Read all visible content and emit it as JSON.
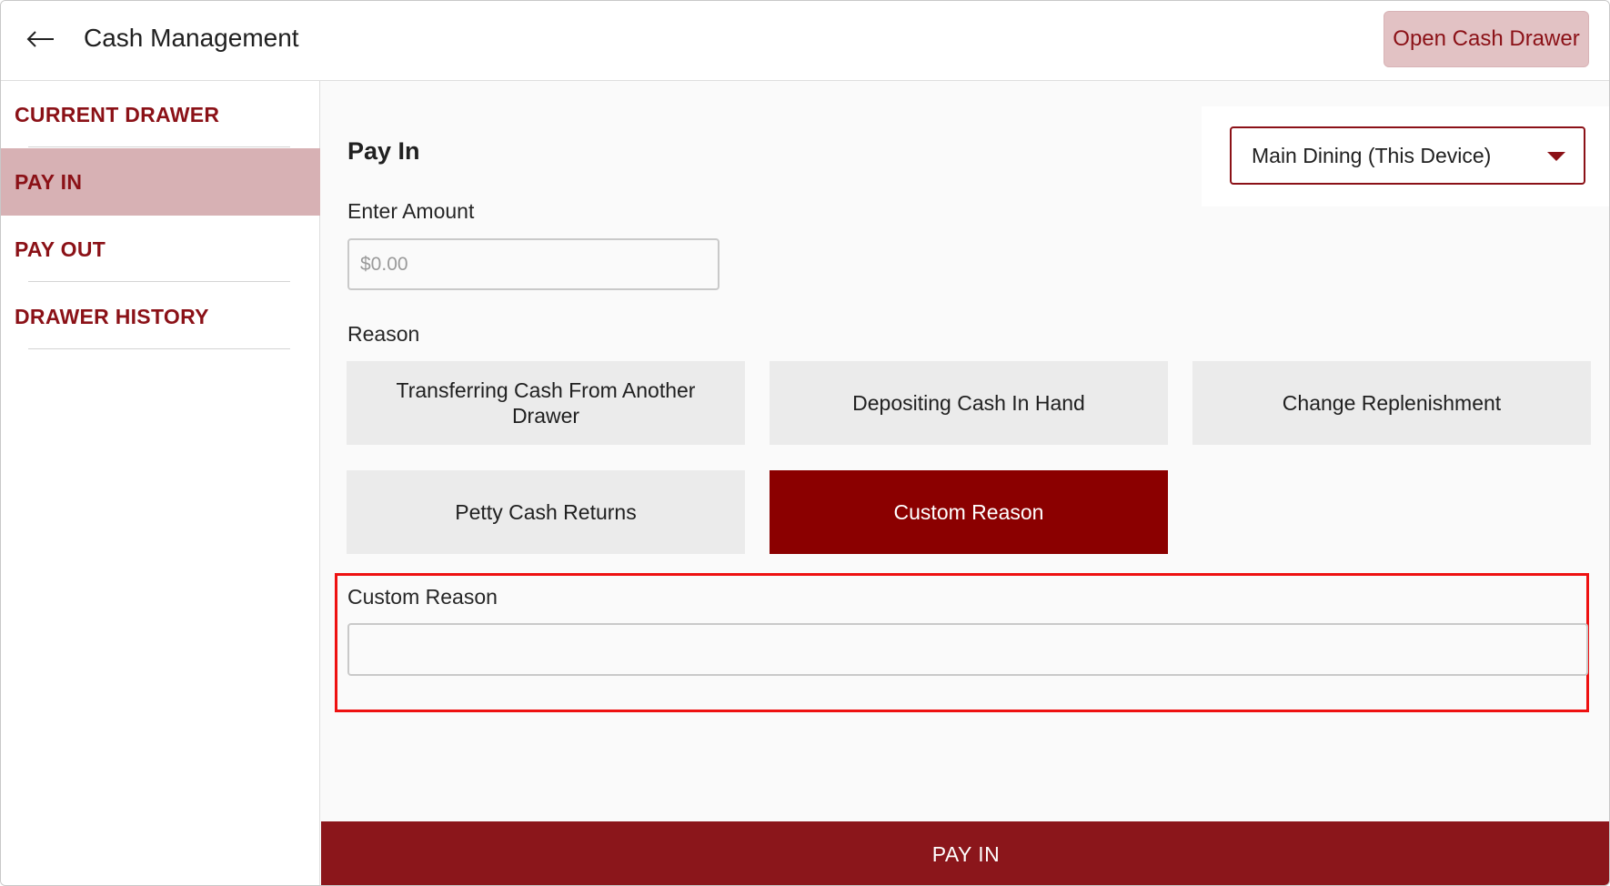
{
  "header": {
    "title": "Cash Management",
    "back_icon": "arrow-left-icon",
    "open_drawer_label": "Open Cash Drawer"
  },
  "sidebar": {
    "items": [
      {
        "label": "CURRENT DRAWER",
        "active": false
      },
      {
        "label": "PAY IN",
        "active": true
      },
      {
        "label": "PAY OUT",
        "active": false
      },
      {
        "label": "DRAWER HISTORY",
        "active": false
      }
    ]
  },
  "main": {
    "section_title": "Pay In",
    "device_select": {
      "value": "Main Dining (This Device)"
    },
    "amount": {
      "label": "Enter Amount",
      "placeholder": "$0.00",
      "value": ""
    },
    "reason": {
      "label": "Reason",
      "options": [
        {
          "label": "Transferring Cash From Another Drawer",
          "selected": false
        },
        {
          "label": "Depositing Cash In Hand",
          "selected": false
        },
        {
          "label": "Change Replenishment",
          "selected": false
        },
        {
          "label": "Petty Cash Returns",
          "selected": false
        },
        {
          "label": "Custom Reason",
          "selected": true
        }
      ]
    },
    "custom_reason": {
      "label": "Custom Reason",
      "value": ""
    },
    "submit_label": "PAY IN"
  },
  "colors": {
    "brand": "#8b1117",
    "selected_reason": "#8b0000",
    "active_nav": "#d7b1b4",
    "highlight": "#ee1111"
  }
}
